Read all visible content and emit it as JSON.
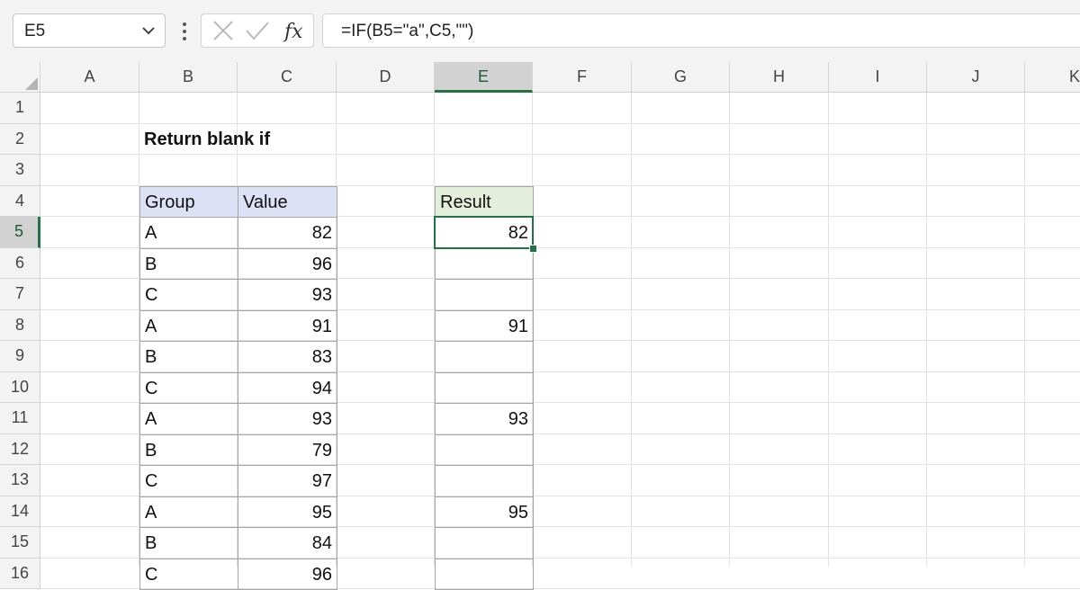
{
  "formula_bar": {
    "name_box": "E5",
    "formula": "=IF(B5=\"a\",C5,\"\")",
    "fx_label": "fx"
  },
  "columns": [
    "A",
    "B",
    "C",
    "D",
    "E",
    "F",
    "G",
    "H",
    "I",
    "J",
    "K"
  ],
  "rows": [
    "1",
    "2",
    "3",
    "4",
    "5",
    "6",
    "7",
    "8",
    "9",
    "10",
    "11",
    "12",
    "13",
    "14",
    "15",
    "16"
  ],
  "selected_cell": "E5",
  "sheet": {
    "title": "Return blank if",
    "headers": {
      "group": "Group",
      "value": "Value",
      "result": "Result"
    },
    "data": [
      {
        "group": "A",
        "value": "82",
        "result": "82"
      },
      {
        "group": "B",
        "value": "96",
        "result": ""
      },
      {
        "group": "C",
        "value": "93",
        "result": ""
      },
      {
        "group": "A",
        "value": "91",
        "result": "91"
      },
      {
        "group": "B",
        "value": "83",
        "result": ""
      },
      {
        "group": "C",
        "value": "94",
        "result": ""
      },
      {
        "group": "A",
        "value": "93",
        "result": "93"
      },
      {
        "group": "B",
        "value": "79",
        "result": ""
      },
      {
        "group": "C",
        "value": "97",
        "result": ""
      },
      {
        "group": "A",
        "value": "95",
        "result": "95"
      },
      {
        "group": "B",
        "value": "84",
        "result": ""
      },
      {
        "group": "C",
        "value": "96",
        "result": ""
      }
    ]
  },
  "colors": {
    "accent": "#217346",
    "table_header": "#dce1f5",
    "result_header": "#e4efdb"
  }
}
